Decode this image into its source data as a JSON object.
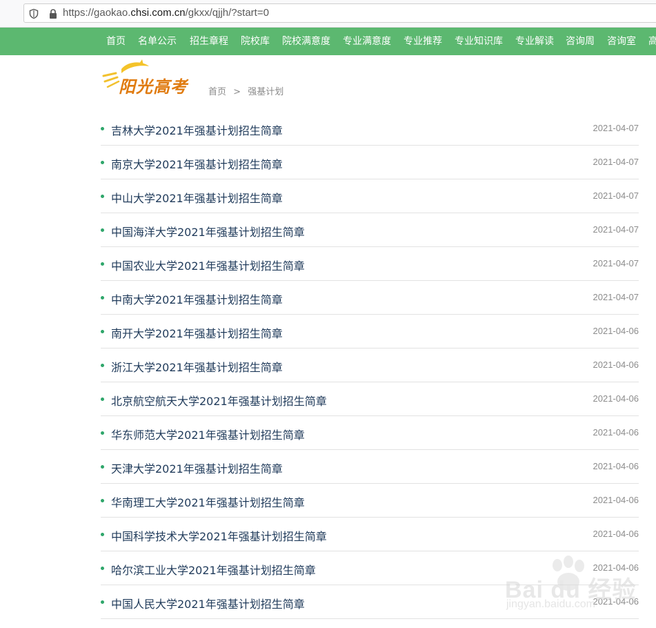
{
  "browser": {
    "url_prefix": "https://gaokao.",
    "url_host": "chsi.com.cn",
    "url_path": "/gkxx/qjjh/?start=0",
    "icons": [
      "shield-icon",
      "lock-icon"
    ]
  },
  "nav": {
    "items": [
      {
        "label": "首页"
      },
      {
        "label": "名单公示"
      },
      {
        "label": "招生章程"
      },
      {
        "label": "院校库"
      },
      {
        "label": "院校满意度"
      },
      {
        "label": "专业满意度"
      },
      {
        "label": "专业推荐"
      },
      {
        "label": "专业知识库"
      },
      {
        "label": "专业解读"
      },
      {
        "label": "咨询周"
      },
      {
        "label": "咨询室"
      },
      {
        "label": "高"
      }
    ],
    "color": "#5cb870"
  },
  "header": {
    "logo_text": "阳光高考",
    "breadcrumb": {
      "home": "首页",
      "separator": ">",
      "current": "强基计划"
    }
  },
  "list": {
    "items": [
      {
        "title": "吉林大学2021年强基计划招生简章",
        "date": "2021-04-07"
      },
      {
        "title": "南京大学2021年强基计划招生简章",
        "date": "2021-04-07"
      },
      {
        "title": "中山大学2021年强基计划招生简章",
        "date": "2021-04-07"
      },
      {
        "title": "中国海洋大学2021年强基计划招生简章",
        "date": "2021-04-07"
      },
      {
        "title": "中国农业大学2021年强基计划招生简章",
        "date": "2021-04-07"
      },
      {
        "title": "中南大学2021年强基计划招生简章",
        "date": "2021-04-07"
      },
      {
        "title": "南开大学2021年强基计划招生简章",
        "date": "2021-04-06"
      },
      {
        "title": "浙江大学2021年强基计划招生简章",
        "date": "2021-04-06"
      },
      {
        "title": "北京航空航天大学2021年强基计划招生简章",
        "date": "2021-04-06"
      },
      {
        "title": "华东师范大学2021年强基计划招生简章",
        "date": "2021-04-06"
      },
      {
        "title": "天津大学2021年强基计划招生简章",
        "date": "2021-04-06"
      },
      {
        "title": "华南理工大学2021年强基计划招生简章",
        "date": "2021-04-06"
      },
      {
        "title": "中国科学技术大学2021年强基计划招生简章",
        "date": "2021-04-06"
      },
      {
        "title": "哈尔滨工业大学2021年强基计划招生简章",
        "date": "2021-04-06"
      },
      {
        "title": "中国人民大学2021年强基计划招生简章",
        "date": "2021-04-06"
      }
    ]
  },
  "watermark": {
    "brand": "Bai du 经验",
    "sub": "jingyan.baidu.com"
  }
}
